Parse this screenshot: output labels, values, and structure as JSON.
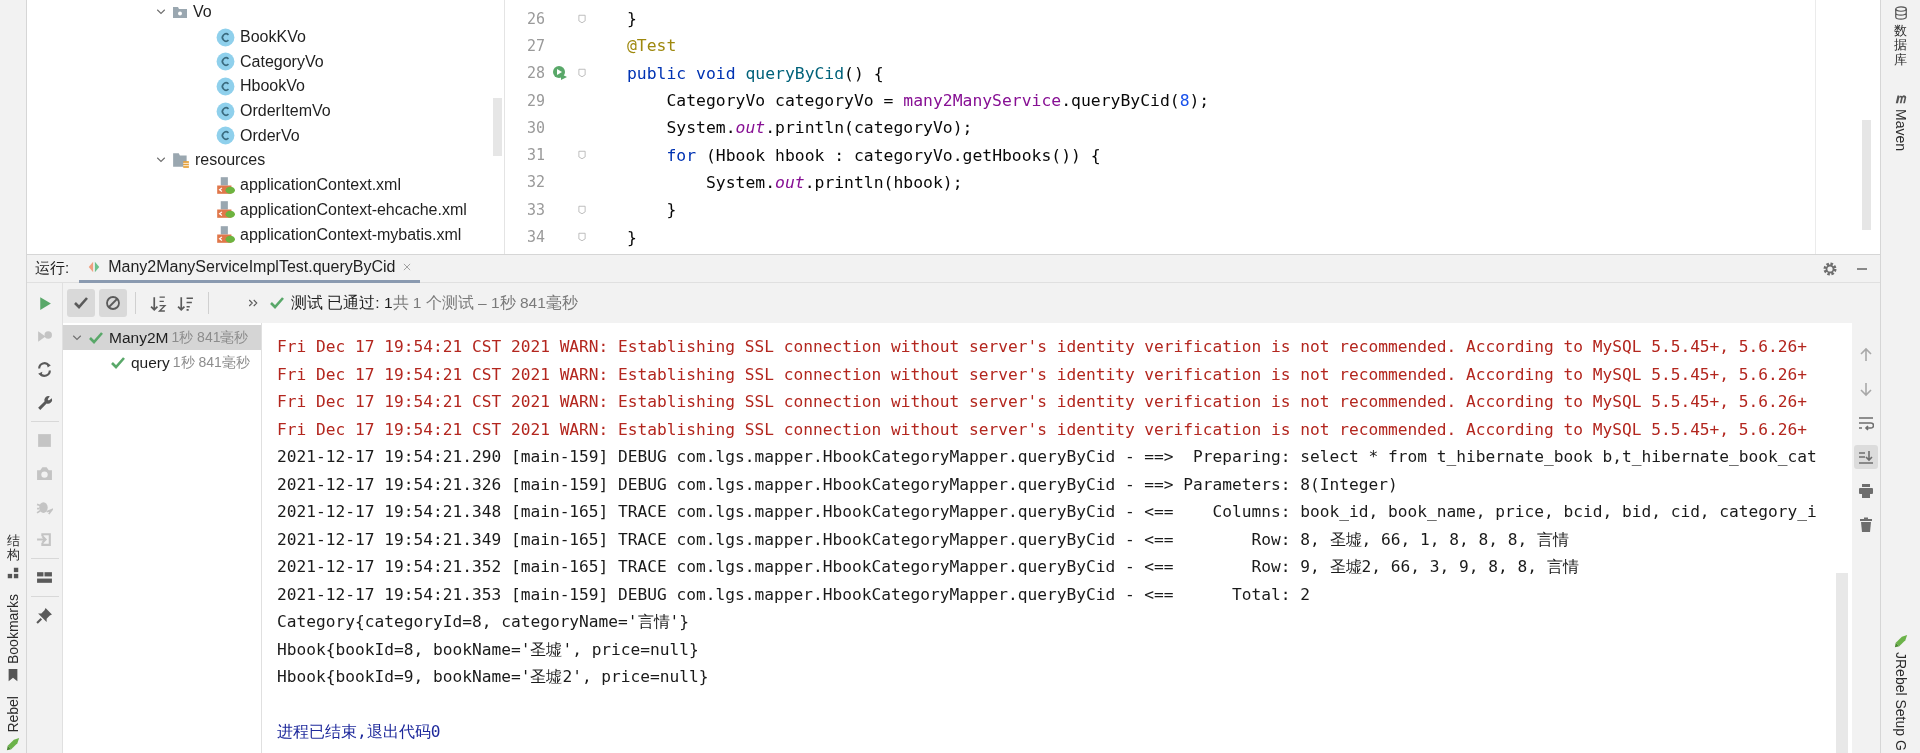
{
  "left_stripe": {
    "tools": [
      {
        "kind": "structure",
        "label": "结构"
      },
      {
        "kind": "bookmarks",
        "label": "Bookmarks"
      },
      {
        "kind": "jrebel",
        "label": "Rebel"
      }
    ]
  },
  "project_tree": {
    "items": [
      {
        "name": "Vo",
        "kind": "package",
        "expanded": true,
        "children": [
          {
            "name": "BookKVo",
            "kind": "class"
          },
          {
            "name": "CategoryVo",
            "kind": "class"
          },
          {
            "name": "HbookVo",
            "kind": "class"
          },
          {
            "name": "OrderItemVo",
            "kind": "class"
          },
          {
            "name": "OrderVo",
            "kind": "class"
          }
        ]
      },
      {
        "name": "resources",
        "kind": "resources",
        "expanded": true,
        "children": [
          {
            "name": "applicationContext.xml",
            "kind": "spring-xml"
          },
          {
            "name": "applicationContext-ehcache.xml",
            "kind": "spring-xml"
          },
          {
            "name": "applicationContext-mybatis.xml",
            "kind": "spring-xml"
          }
        ]
      }
    ]
  },
  "editor": {
    "lines": [
      {
        "number": "26",
        "fold": true,
        "run_marker": false,
        "tokens": [
          {
            "kind": "plain",
            "text": "}"
          }
        ]
      },
      {
        "number": "27",
        "fold": false,
        "run_marker": false,
        "tokens": [
          {
            "kind": "annotation",
            "text": "@Test"
          }
        ]
      },
      {
        "number": "28",
        "fold": true,
        "run_marker": true,
        "tokens": [
          {
            "kind": "keyword",
            "text": "public void "
          },
          {
            "kind": "method",
            "text": "queryByCid"
          },
          {
            "kind": "plain",
            "text": "() {"
          }
        ]
      },
      {
        "number": "29",
        "fold": false,
        "run_marker": false,
        "tokens": [
          {
            "kind": "plain",
            "text": "    CategoryVo categoryVo = "
          },
          {
            "kind": "field",
            "text": "many2ManyService"
          },
          {
            "kind": "plain",
            "text": ".queryByCid("
          },
          {
            "kind": "number",
            "text": "8"
          },
          {
            "kind": "plain",
            "text": ");"
          }
        ]
      },
      {
        "number": "30",
        "fold": false,
        "run_marker": false,
        "tokens": [
          {
            "kind": "plain",
            "text": "    System."
          },
          {
            "kind": "static",
            "text": "out"
          },
          {
            "kind": "plain",
            "text": ".println(categoryVo);"
          }
        ]
      },
      {
        "number": "31",
        "fold": true,
        "run_marker": false,
        "tokens": [
          {
            "kind": "keyword",
            "text": "    for "
          },
          {
            "kind": "plain",
            "text": "(Hbook hbook : categoryVo.getHbooks()) {"
          }
        ]
      },
      {
        "number": "32",
        "fold": false,
        "run_marker": false,
        "tokens": [
          {
            "kind": "plain",
            "text": "        System."
          },
          {
            "kind": "static",
            "text": "out"
          },
          {
            "kind": "plain",
            "text": ".println(hbook);"
          }
        ]
      },
      {
        "number": "33",
        "fold": true,
        "run_marker": false,
        "tokens": [
          {
            "kind": "plain",
            "text": "    }"
          }
        ]
      },
      {
        "number": "34",
        "fold": true,
        "run_marker": false,
        "tokens": [
          {
            "kind": "plain",
            "text": "}"
          }
        ]
      }
    ]
  },
  "right_stripe": {
    "tools": [
      {
        "kind": "database",
        "label": "数据库"
      },
      {
        "kind": "maven",
        "label": "Maven"
      },
      {
        "kind": "jrebel",
        "label": "JRebel Setup G"
      }
    ]
  },
  "run_panel": {
    "label": "运行:",
    "tabs": [
      {
        "label": "Many2ManyServiceImplTest.queryByCid",
        "selected": true
      }
    ],
    "side_tools": [
      {
        "kind": "run",
        "disabled": false
      },
      {
        "kind": "rerun-failed",
        "disabled": true
      },
      {
        "kind": "auto-test",
        "disabled": false
      },
      {
        "kind": "wrench",
        "disabled": false
      },
      {
        "kind": "stop",
        "disabled": true
      },
      {
        "kind": "camera",
        "disabled": true
      },
      {
        "kind": "debug",
        "disabled": true
      },
      {
        "kind": "import",
        "disabled": true
      },
      {
        "kind": "layout",
        "disabled": false
      },
      {
        "kind": "pin",
        "disabled": false
      }
    ],
    "filters": [
      {
        "kind": "passed",
        "selected": true
      },
      {
        "kind": "ignored",
        "selected": true
      }
    ],
    "status": {
      "passed": true,
      "label": "测试 已通过: 1",
      "detail": "共 1 个测试 – 1秒 841毫秒"
    },
    "test_tree": [
      {
        "name": "Many2M",
        "time": "1秒 841毫秒",
        "passed": true,
        "selected": true,
        "expanded": true,
        "children": [
          {
            "name": "query",
            "time": "1秒 841毫秒",
            "passed": true,
            "selected": false
          }
        ]
      }
    ],
    "console": {
      "lines": [
        {
          "kind": "warn",
          "text": "Fri Dec 17 19:54:21 CST 2021 WARN: Establishing SSL connection without server's identity verification is not recommended. According to MySQL 5.5.45+, 5.6.26+"
        },
        {
          "kind": "warn",
          "text": "Fri Dec 17 19:54:21 CST 2021 WARN: Establishing SSL connection without server's identity verification is not recommended. According to MySQL 5.5.45+, 5.6.26+"
        },
        {
          "kind": "warn",
          "text": "Fri Dec 17 19:54:21 CST 2021 WARN: Establishing SSL connection without server's identity verification is not recommended. According to MySQL 5.5.45+, 5.6.26+"
        },
        {
          "kind": "warn",
          "text": "Fri Dec 17 19:54:21 CST 2021 WARN: Establishing SSL connection without server's identity verification is not recommended. According to MySQL 5.5.45+, 5.6.26+"
        },
        {
          "kind": "log",
          "text": "2021-12-17 19:54:21.290 [main-159] DEBUG com.lgs.mapper.HbookCategoryMapper.queryByCid - ==>  Preparing: select * from t_hibernate_book b,t_hibernate_book_cat"
        },
        {
          "kind": "log",
          "text": "2021-12-17 19:54:21.326 [main-159] DEBUG com.lgs.mapper.HbookCategoryMapper.queryByCid - ==> Parameters: 8(Integer)"
        },
        {
          "kind": "log",
          "text": "2021-12-17 19:54:21.348 [main-165] TRACE com.lgs.mapper.HbookCategoryMapper.queryByCid - <==    Columns: book_id, book_name, price, bcid, bid, cid, category_i"
        },
        {
          "kind": "log",
          "text": "2021-12-17 19:54:21.349 [main-165] TRACE com.lgs.mapper.HbookCategoryMapper.queryByCid - <==        Row: 8, 圣墟, 66, 1, 8, 8, 8, 言情"
        },
        {
          "kind": "log",
          "text": "2021-12-17 19:54:21.352 [main-165] TRACE com.lgs.mapper.HbookCategoryMapper.queryByCid - <==        Row: 9, 圣墟2, 66, 3, 9, 8, 8, 言情"
        },
        {
          "kind": "log",
          "text": "2021-12-17 19:54:21.353 [main-159] DEBUG com.lgs.mapper.HbookCategoryMapper.queryByCid - <==      Total: 2"
        },
        {
          "kind": "log",
          "text": "Category{categoryId=8, categoryName='言情'}"
        },
        {
          "kind": "log",
          "text": "Hbook{bookId=8, bookName='圣墟', price=null}"
        },
        {
          "kind": "log",
          "text": "Hbook{bookId=9, bookName='圣墟2', price=null}"
        },
        {
          "kind": "blank"
        },
        {
          "kind": "exit",
          "text": "进程已结束,退出代码0"
        }
      ],
      "tools": [
        {
          "kind": "up",
          "selected": false
        },
        {
          "kind": "down",
          "selected": false
        },
        {
          "kind": "wrap",
          "selected": false
        },
        {
          "kind": "scroll-end",
          "selected": true
        },
        {
          "kind": "print",
          "selected": false
        },
        {
          "kind": "trash",
          "selected": false
        }
      ]
    }
  }
}
